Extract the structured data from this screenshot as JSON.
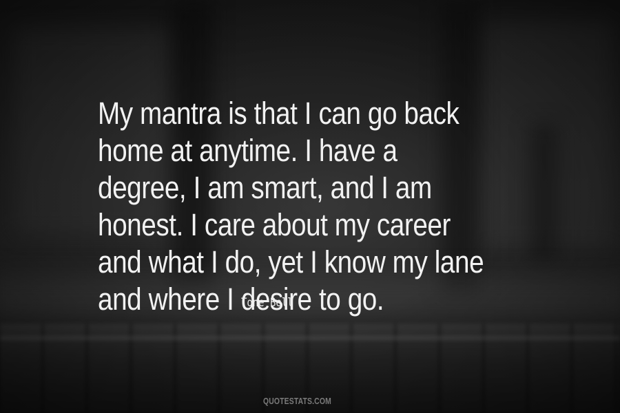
{
  "quote": {
    "lines": [
      "My mantra is that I can go back",
      "home at anytime. I have a",
      "degree, I am smart, and I am",
      "honest. I care about my career",
      "and what I do, yet I know my lane",
      "and where I desire to go."
    ],
    "author": "Tone Bell"
  },
  "watermark": "QUOTESTATS.COM",
  "colors": {
    "text": "#f2f2f2",
    "watermark": "#7a7a7a",
    "background": "#1e1e1e"
  }
}
